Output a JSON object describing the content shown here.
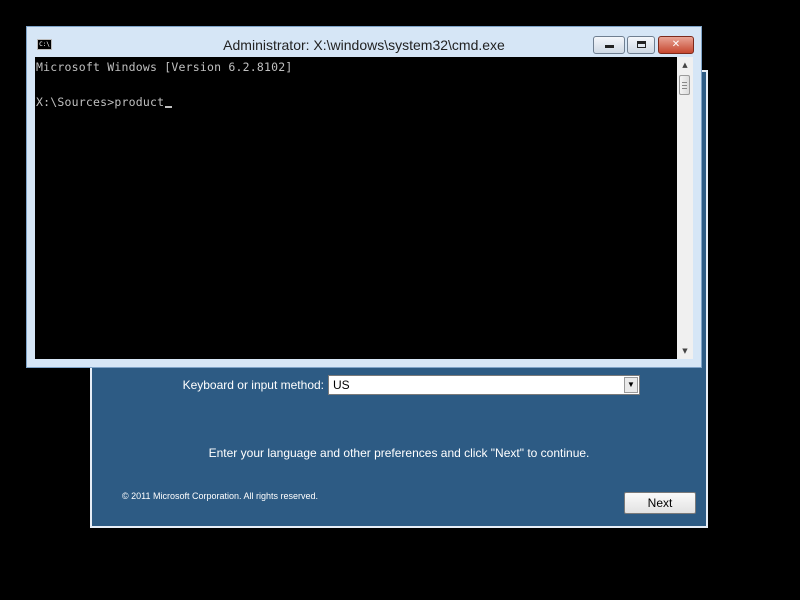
{
  "setup": {
    "keyboard_label": "Keyboard or input method:",
    "keyboard_value": "US",
    "instructions": "Enter your language and other preferences and click \"Next\" to continue.",
    "copyright": "© 2011 Microsoft Corporation. All rights reserved.",
    "next_label": "Next",
    "background_color": "#2d5b84"
  },
  "cmd": {
    "title": "Administrator: X:\\windows\\system32\\cmd.exe",
    "icon_text": "C:\\",
    "lines": [
      "Microsoft Windows [Version 6.2.8102]",
      "",
      "X:\\Sources>product"
    ],
    "text_color": "#c0c0c0",
    "background_color": "#000000"
  },
  "icons": {
    "minimize": "minimize-icon",
    "maximize": "maximize-icon",
    "close": "close-icon",
    "dropdown": "chevron-down-icon"
  }
}
